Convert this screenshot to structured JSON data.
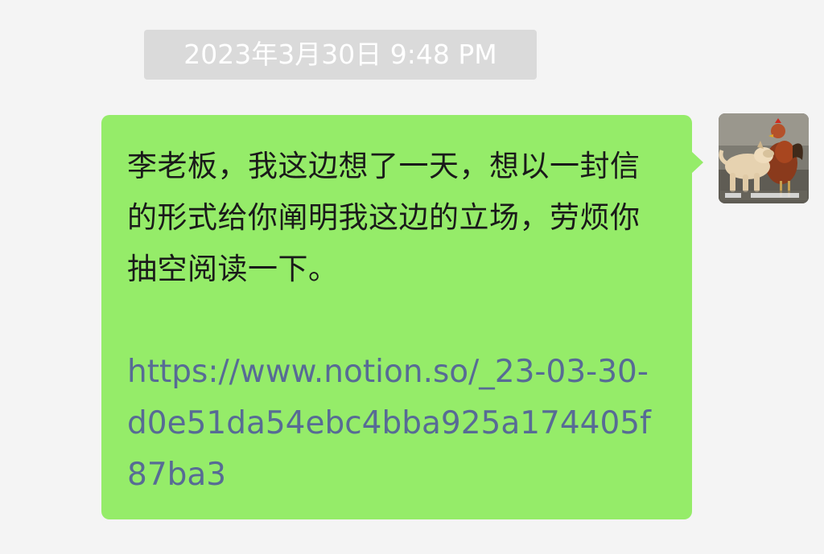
{
  "chat": {
    "timestamp": "2023年3月30日 9:48 PM",
    "messages": [
      {
        "sender": "self",
        "text": "李老板，我这边想了一天，想以一封信的形式给你阐明我这边的立场，劳烦你抽空阅读一下。",
        "link": "https://www.notion.so/_23-03-30-d0e51da54ebc4bba925a174405f87ba3",
        "bubble_color": "#95ec69",
        "link_color": "#576b95"
      }
    ],
    "avatar": {
      "icon": "dog-and-rooster-photo-avatar"
    }
  },
  "colors": {
    "background": "#f4f4f4",
    "timestamp_bg": "#dadada",
    "timestamp_text": "#ffffff"
  }
}
